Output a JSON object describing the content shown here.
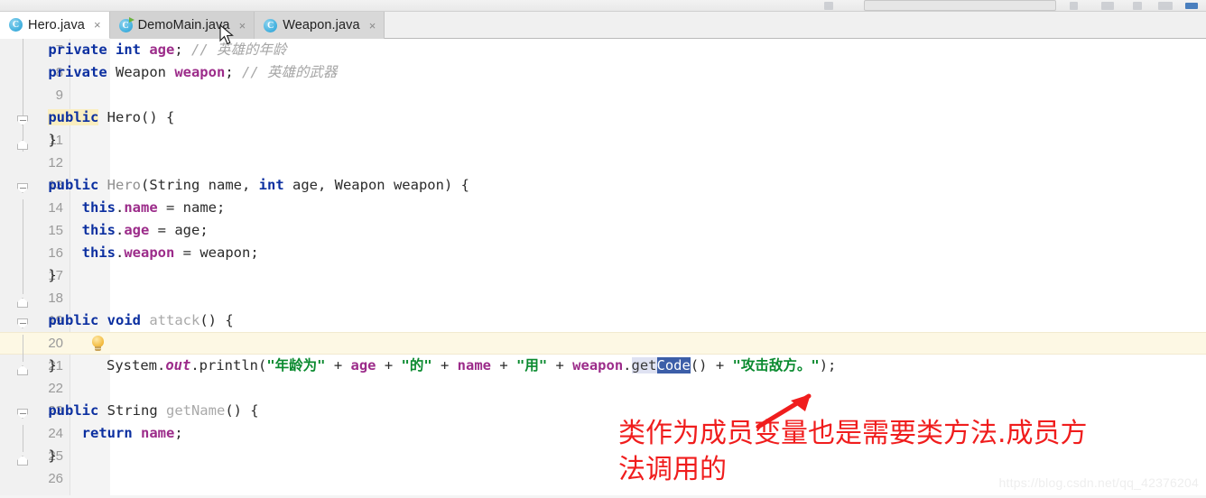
{
  "window": {
    "app": "IntelliJ IDEA",
    "toolbar_visible_hint": "partially-cropped-toolbar"
  },
  "tabs": [
    {
      "label": "Hero.java",
      "icon": "java-class-icon",
      "state": "active",
      "close_glyph": "×"
    },
    {
      "label": "DemoMain.java",
      "icon": "java-class-runnable-icon",
      "state": "hover",
      "close_glyph": "×"
    },
    {
      "label": "Weapon.java",
      "icon": "java-class-icon",
      "state": "inactive",
      "close_glyph": "×"
    }
  ],
  "editor": {
    "file": "Hero.java",
    "current_line": 20,
    "first_visible_line": 7,
    "last_visible_line": 26,
    "gutter_icon": "intention-bulb-icon",
    "selection": "Code",
    "lines": [
      {
        "n": 7,
        "text": "    private int age; // 英雄的年龄"
      },
      {
        "n": 8,
        "text": "    private Weapon weapon; // 英雄的武器"
      },
      {
        "n": 9,
        "text": ""
      },
      {
        "n": 10,
        "text": "    public Hero() {"
      },
      {
        "n": 11,
        "text": "    }"
      },
      {
        "n": 12,
        "text": ""
      },
      {
        "n": 13,
        "text": "    public Hero(String name, int age, Weapon weapon) {"
      },
      {
        "n": 14,
        "text": "        this.name = name;"
      },
      {
        "n": 15,
        "text": "        this.age = age;"
      },
      {
        "n": 16,
        "text": "        this.weapon = weapon;"
      },
      {
        "n": 17,
        "text": "    }"
      },
      {
        "n": 18,
        "text": ""
      },
      {
        "n": 19,
        "text": "    public void attack() {"
      },
      {
        "n": 20,
        "text": "        System.out.println(\"年龄为\" + age + \"的\" + name + \"用\" + weapon.getCode() + \"攻击敌方。\");"
      },
      {
        "n": 21,
        "text": "    }"
      },
      {
        "n": 22,
        "text": ""
      },
      {
        "n": 23,
        "text": "    public String getName() {"
      },
      {
        "n": 24,
        "text": "        return name;"
      },
      {
        "n": 25,
        "text": "    }"
      },
      {
        "n": 26,
        "text": ""
      }
    ],
    "tokens": {
      "l7": [
        [
          "kw",
          "private"
        ],
        [
          "plain",
          " "
        ],
        [
          "kw",
          "int"
        ],
        [
          "plain",
          " "
        ],
        [
          "fld",
          "age"
        ],
        [
          "plain",
          "; "
        ],
        [
          "cmt",
          "// 英雄的年龄"
        ]
      ],
      "l8": [
        [
          "kw",
          "private"
        ],
        [
          "plain",
          " Weapon "
        ],
        [
          "fld",
          "weapon"
        ],
        [
          "plain",
          "; "
        ],
        [
          "cmt",
          "// 英雄的武器"
        ]
      ],
      "l10": [
        [
          "kwhl",
          "public"
        ],
        [
          "plain",
          " Hero() {"
        ]
      ],
      "l11": [
        [
          "plain",
          "}"
        ]
      ],
      "l13": [
        [
          "kw",
          "public"
        ],
        [
          "plain",
          " "
        ],
        [
          "type",
          "Hero"
        ],
        [
          "plain",
          "(String name, "
        ],
        [
          "kw",
          "int"
        ],
        [
          "plain",
          " age, Weapon weapon) {"
        ]
      ],
      "l14": [
        [
          "kw",
          "this"
        ],
        [
          "plain",
          "."
        ],
        [
          "fld",
          "name"
        ],
        [
          "plain",
          " = name;"
        ]
      ],
      "l15": [
        [
          "kw",
          "this"
        ],
        [
          "plain",
          "."
        ],
        [
          "fld",
          "age"
        ],
        [
          "plain",
          " = age;"
        ]
      ],
      "l16": [
        [
          "kw",
          "this"
        ],
        [
          "plain",
          "."
        ],
        [
          "fld",
          "weapon"
        ],
        [
          "plain",
          " = weapon;"
        ]
      ],
      "l17": [
        [
          "plain",
          "}"
        ]
      ],
      "l19": [
        [
          "kw",
          "public"
        ],
        [
          "plain",
          " "
        ],
        [
          "kw",
          "void"
        ],
        [
          "plain",
          " "
        ],
        [
          "mth",
          "attack"
        ],
        [
          "plain",
          "() {"
        ]
      ],
      "l21": [
        [
          "plain",
          "}"
        ]
      ],
      "l23": [
        [
          "kw",
          "public"
        ],
        [
          "plain",
          " String "
        ],
        [
          "mth",
          "getName"
        ],
        [
          "plain",
          "() {"
        ]
      ],
      "l24": [
        [
          "kw",
          "return"
        ],
        [
          "plain",
          " "
        ],
        [
          "fld",
          "name"
        ],
        [
          "plain",
          ";"
        ]
      ],
      "l25": [
        [
          "plain",
          "}"
        ]
      ]
    }
  },
  "annotation": {
    "text": "类作为成员变量也是需要类方法.成员方\n法调用的",
    "color": "#f01d1d",
    "arrow": "red-arrow-pointing-upright"
  },
  "watermark": {
    "text": "https://blog.csdn.net/qq_42376204"
  },
  "colors": {
    "keyword": "#0b2fa0",
    "field": "#9c2c8a",
    "string": "#0a8a2f",
    "comment": "#a6a6a6",
    "current_line_bg": "#fdf8e4",
    "selection_bg": "#3c5ea8",
    "identifier_occurrence_bg": "#dfe2f2",
    "annotation_red": "#f01d1d",
    "gutter_bg": "#f1f1f1"
  }
}
